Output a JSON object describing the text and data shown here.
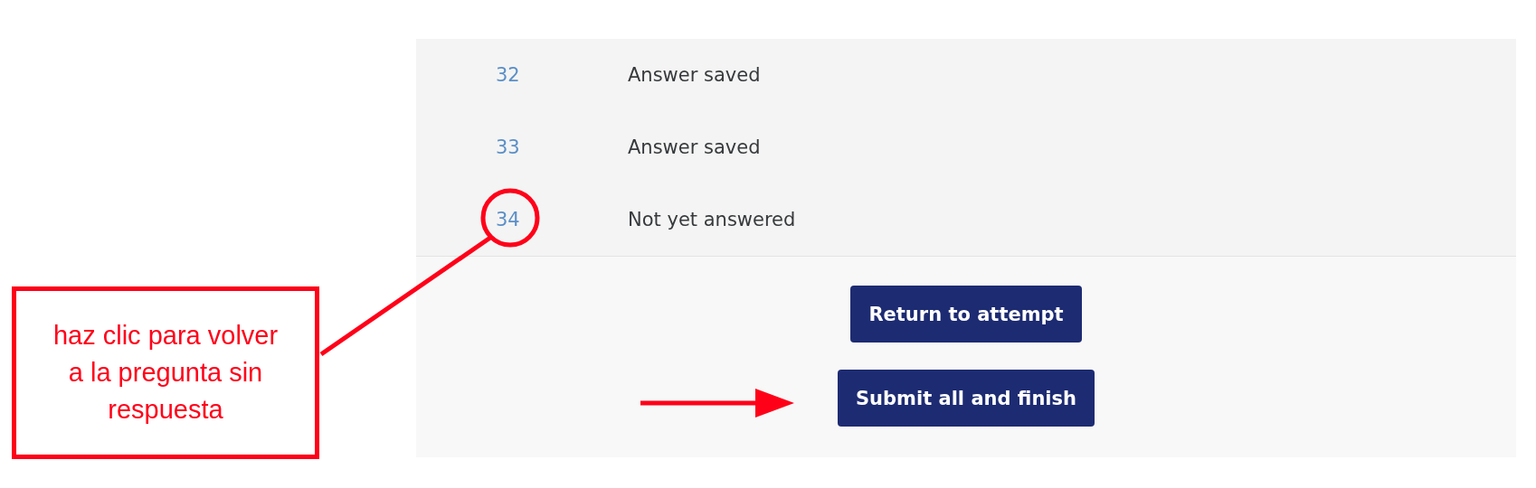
{
  "rows": [
    {
      "number": "32",
      "status": "Answer saved"
    },
    {
      "number": "33",
      "status": "Answer saved"
    },
    {
      "number": "34",
      "status": "Not yet answered"
    }
  ],
  "buttons": [
    "Return to attempt",
    "Submit all and finish"
  ],
  "callout": {
    "text": "haz clic para volver a la pregunta sin respuesta"
  }
}
